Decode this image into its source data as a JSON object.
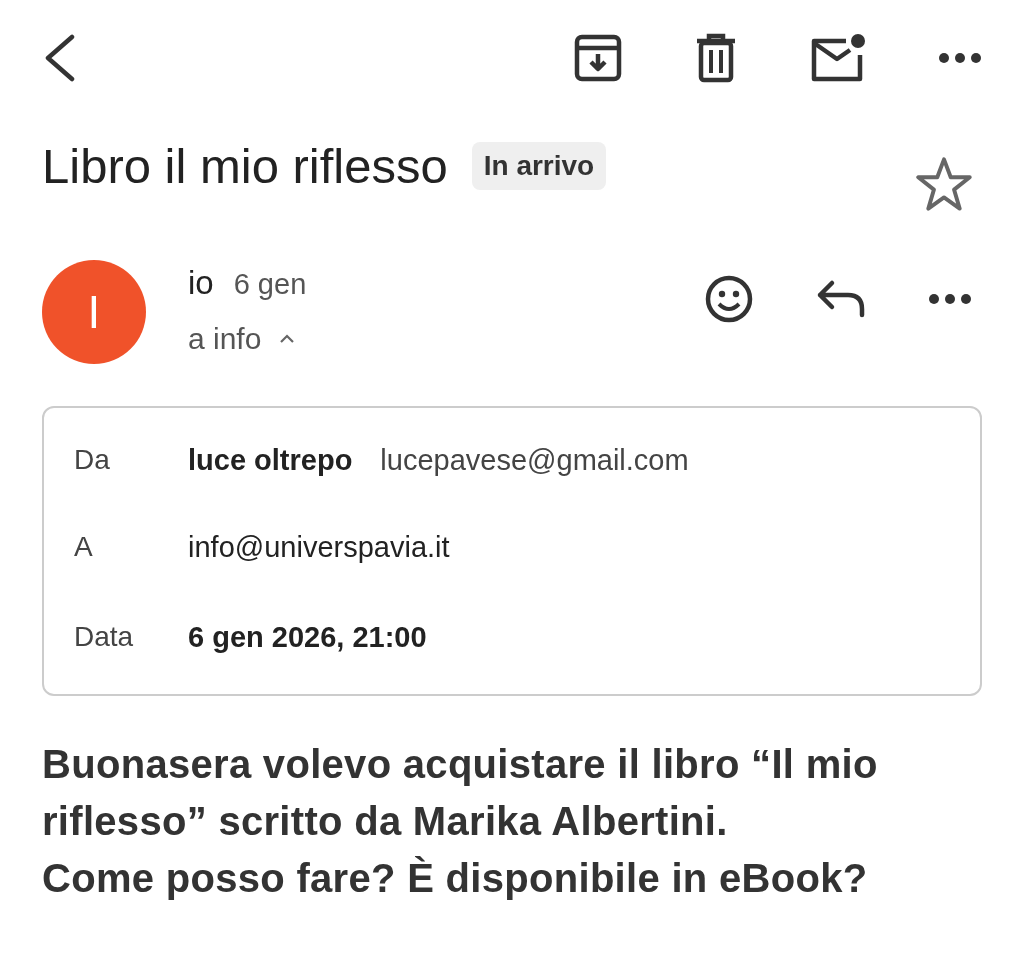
{
  "subject": {
    "title": "Libro il mio riflesso",
    "label": "In arrivo",
    "starred": false
  },
  "message": {
    "avatar_letter": "I",
    "sender": "io",
    "date": "6 gen",
    "recipients": "a info",
    "expanded": true
  },
  "details": [
    {
      "label": "Da",
      "name": "luce oltrepo",
      "value": "lucepavese@gmail.com"
    },
    {
      "label": "A",
      "value": "info@universpavia.it"
    },
    {
      "label": "Data",
      "value": "6 gen 2026, 21:00"
    }
  ],
  "body": [
    "Buonasera volevo acquistare il libro “Il mio riflesso” scritto da Marika Albertini.",
    "Come posso fare? È disponibile in eBook?"
  ]
}
